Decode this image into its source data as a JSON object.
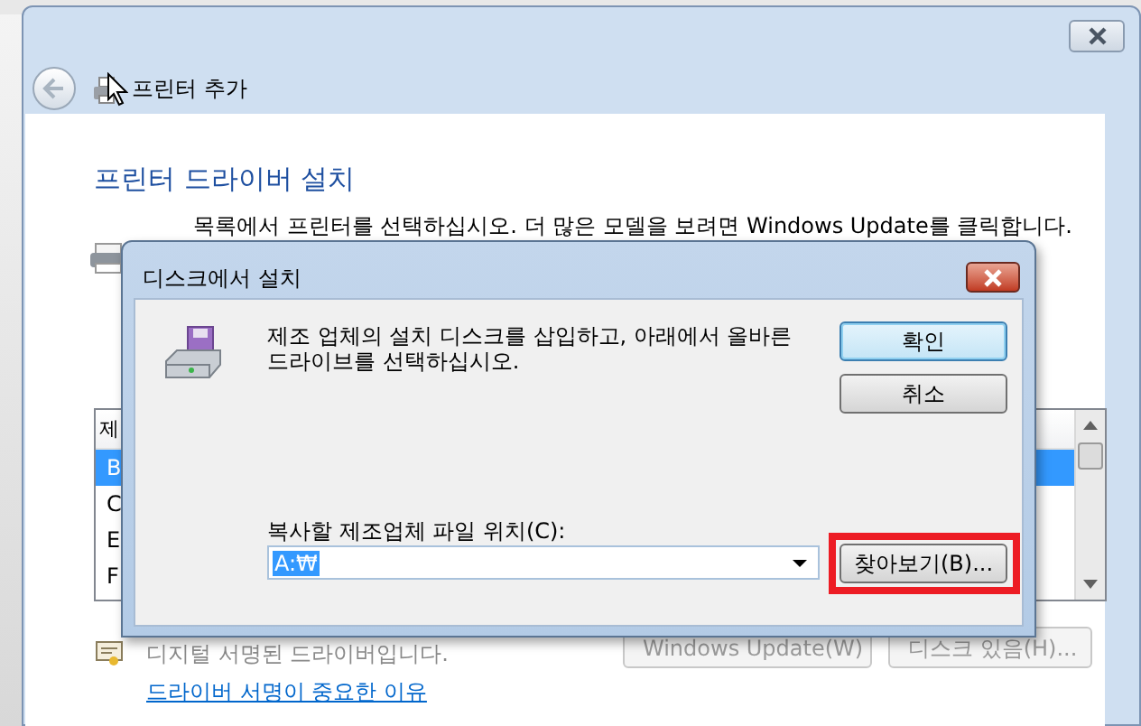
{
  "main_window": {
    "title": "프린터 추가",
    "heading": "프린터 드라이버 설치",
    "instruction": "목록에서 프린터를 선택하십시오. 더 많은 모델을 보려면 Windows Update를 클릭합니다.",
    "list": {
      "header": "제",
      "items": [
        {
          "label": "B",
          "selected": true
        },
        {
          "label": "C",
          "selected": false
        },
        {
          "label": "E",
          "selected": false
        },
        {
          "label": "F",
          "selected": false
        }
      ]
    },
    "signature_note": "디지털 서명된 드라이버입니다.",
    "signature_link": "드라이버 서명이 중요한 이유",
    "buttons": [
      {
        "label": "Windows Update(W)",
        "disabled": true
      },
      {
        "label": "디스크 있음(H)...",
        "disabled": true
      }
    ]
  },
  "dialog": {
    "title": "디스크에서 설치",
    "message": "제조 업체의 설치 디스크를 삽입하고, 아래에서 올바른 드라이브를 선택하십시오.",
    "ok": "확인",
    "cancel": "취소",
    "location_label": "복사할 제조업체 파일 위치(C):",
    "location_value": "A:₩",
    "browse": "찾아보기(B)...",
    "browse_highlighted": true
  }
}
